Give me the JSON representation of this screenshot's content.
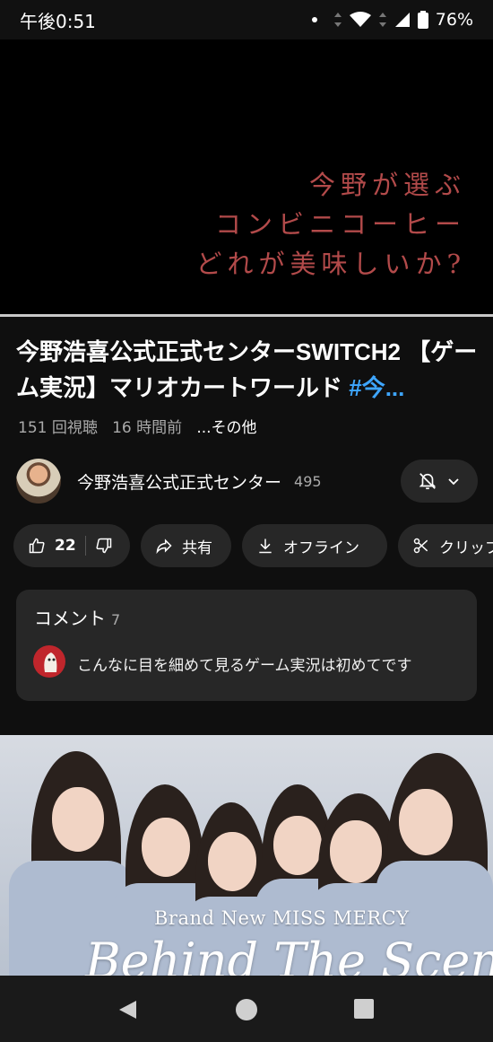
{
  "status_bar": {
    "time": "午後0:51",
    "battery": "76%"
  },
  "player": {
    "overlay_lines": [
      "今野が選ぶ",
      "コンビニコーヒー",
      "どれが美味しいか?"
    ]
  },
  "video": {
    "title": "今野浩喜公式正式センターSWITCH2 【ゲーム実況】マリオカートワールド",
    "hashtag": "#今...",
    "views": "151 回視聴",
    "age": "16 時間前",
    "more": "...その他"
  },
  "channel": {
    "name": "今野浩喜公式正式センター",
    "subscribers": "495"
  },
  "actions": {
    "like_count": "22",
    "share": "共有",
    "offline": "オフライン",
    "clip": "クリップ"
  },
  "comments": {
    "title": "コメント",
    "count": "7",
    "top_comment": "こんなに目を細めて見るゲーム実況は初めてです"
  },
  "next_video": {
    "subtitle": "Brand New MISS MERCY",
    "main_text": "Behind The Scenes"
  },
  "colors": {
    "accent_link": "#3ea6ff",
    "overlay_text": "#b24a4a",
    "chip_bg": "#272727"
  },
  "icons": {
    "like": "thumbs-up-icon",
    "dislike": "thumbs-down-icon",
    "share": "share-arrow-icon",
    "offline": "download-icon",
    "clip": "scissors-icon",
    "bell": "bell-off-icon"
  }
}
